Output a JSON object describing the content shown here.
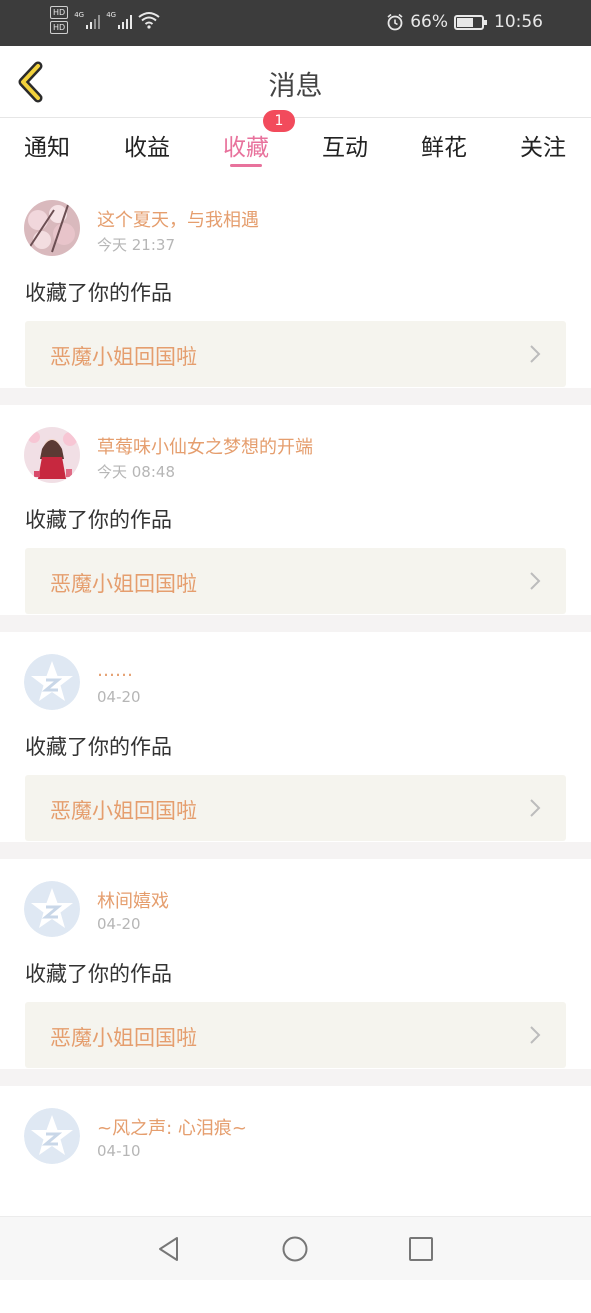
{
  "status_bar": {
    "sim1_hd": "HD",
    "sim2_hd": "HD",
    "sim1_net": "4G",
    "sim2_net": "4G",
    "battery_pct_text": "66%",
    "battery_level": 0.66,
    "time": "10:56",
    "alarm_icon": "alarm-icon",
    "wifi_icon": "wifi-icon"
  },
  "header": {
    "title": "消息",
    "back_icon": "chevron-left-icon"
  },
  "tabs": {
    "items": [
      "通知",
      "收益",
      "收藏",
      "互动",
      "鲜花",
      "关注"
    ],
    "active": "收藏",
    "badge": "1"
  },
  "messages": [
    {
      "user": "这个夏天，与我相遇",
      "time": "今天 21:37",
      "action": "收藏了你的作品",
      "work": "恶魔小姐回国啦",
      "avatar": "flower-photo"
    },
    {
      "user": "草莓味小仙女之梦想的开端",
      "time": "今天 08:48",
      "action": "收藏了你的作品",
      "work": "恶魔小姐回国啦",
      "avatar": "girl-photo"
    },
    {
      "user": "……",
      "time": "04-20",
      "action": "收藏了你的作品",
      "work": "恶魔小姐回国啦",
      "avatar": "default-star-avatar"
    },
    {
      "user": "林间嬉戏",
      "time": "04-20",
      "action": "收藏了你的作品",
      "work": "恶魔小姐回国啦",
      "avatar": "default-star-avatar"
    },
    {
      "user": "~风之声: 心泪痕~",
      "time": "04-10",
      "action": "",
      "work": "",
      "avatar": "default-star-avatar"
    }
  ],
  "colors": {
    "accent_pink": "#e8729c",
    "name_orange": "#e59e6e",
    "badge_red": "#f24b5c",
    "back_icon_yellow": "#f2d23c"
  }
}
